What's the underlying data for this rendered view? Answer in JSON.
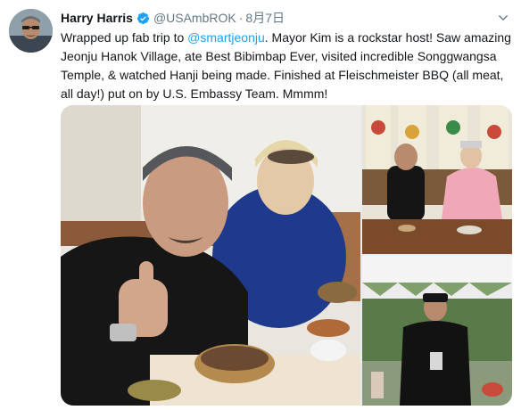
{
  "tweet": {
    "author_name": "Harry Harris",
    "handle": "@USAmbROK",
    "separator": "·",
    "date": "8月7日",
    "text_parts": [
      {
        "text": "Wrapped up fab trip to ",
        "type": "plain"
      },
      {
        "text": "@smartjeonju",
        "type": "mention"
      },
      {
        "text": ". Mayor Kim is a rockstar host!  Saw amazing Jeonju Hanok Village, ate Best Bibimbap Ever, visited incredible Songgwangsa Temple, & watched Hanji being made.  Finished at Fleischmeister BBQ (all meat, all day!) put on by U.S. Embassy Team. Mmmm!",
        "type": "plain"
      }
    ]
  },
  "icons": {
    "verified": "verified-badge-icon",
    "menu": "chevron-down-icon"
  },
  "colors": {
    "text": "#14171a",
    "secondary": "#657786",
    "link": "#1da1f2",
    "verified": "#1da1f2"
  },
  "media": {
    "photo_count": 3
  }
}
